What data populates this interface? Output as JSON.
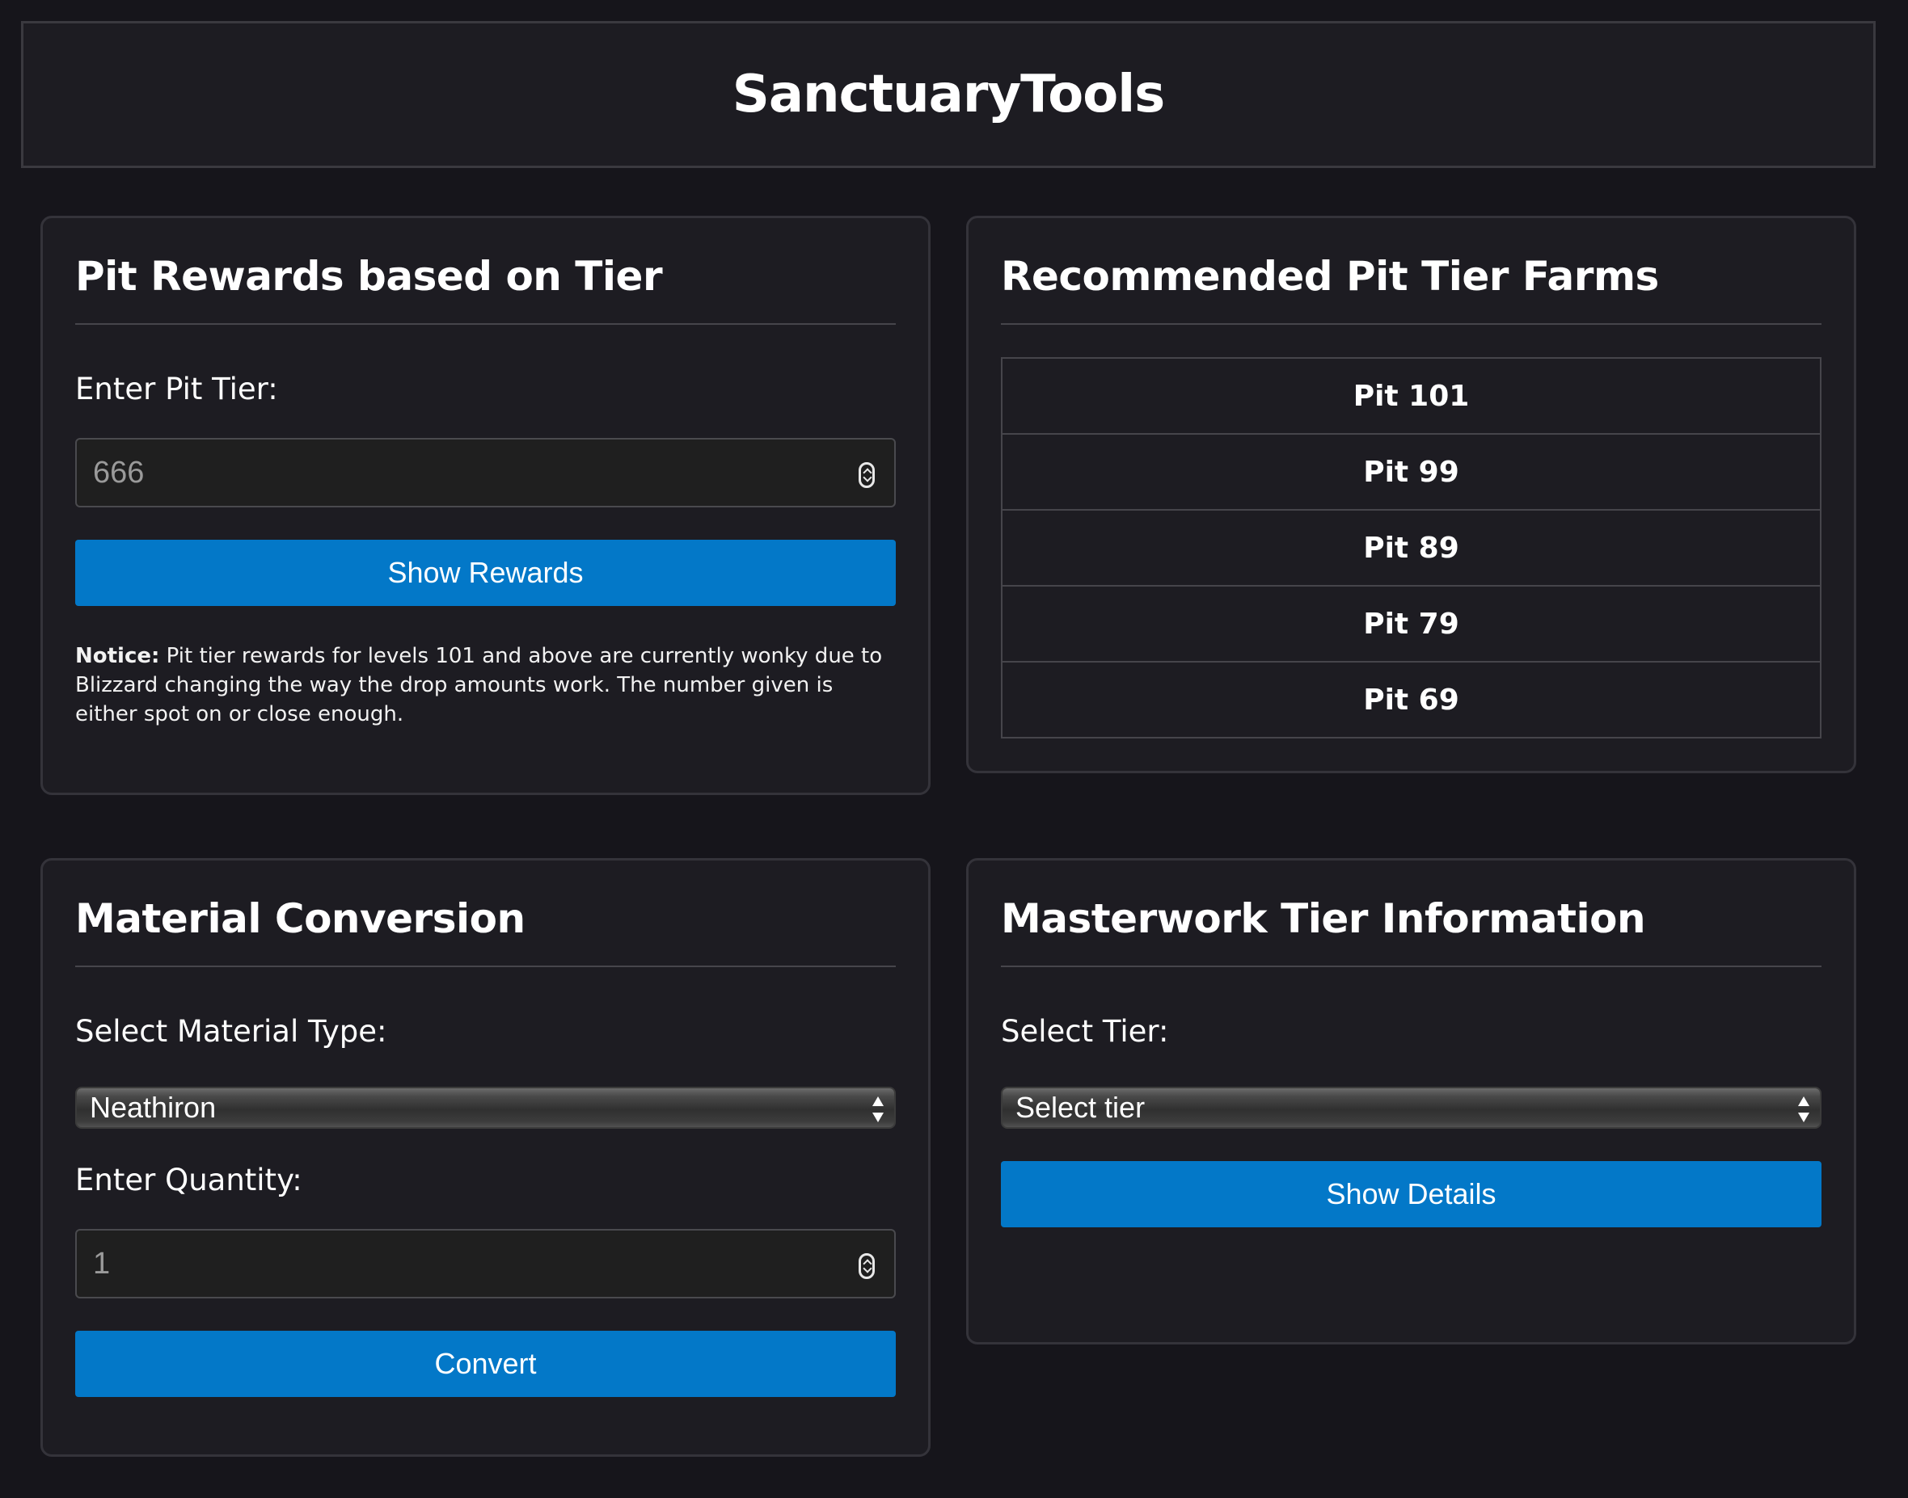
{
  "header": {
    "title": "SanctuaryTools"
  },
  "pit_rewards": {
    "title": "Pit Rewards based on Tier",
    "label": "Enter Pit Tier:",
    "input_value": "666",
    "button_label": "Show Rewards",
    "notice_bold": "Notice:",
    "notice_text": " Pit tier rewards for levels 101 and above are currently wonky due to Blizzard changing the way the drop amounts work. The number given is either spot on or close enough."
  },
  "recommended": {
    "title": "Recommended Pit Tier Farms",
    "rows": [
      "Pit 101",
      "Pit 99",
      "Pit 89",
      "Pit 79",
      "Pit 69"
    ]
  },
  "material": {
    "title": "Material Conversion",
    "type_label": "Select Material Type:",
    "type_selected": "Neathiron",
    "quantity_label": "Enter Quantity:",
    "quantity_value": "1",
    "button_label": "Convert"
  },
  "masterwork": {
    "title": "Masterwork Tier Information",
    "tier_label": "Select Tier:",
    "tier_selected": "Select tier",
    "button_label": "Show Details"
  },
  "colors": {
    "background": "#16151b",
    "card": "#1d1c22",
    "button": "#0378c8"
  }
}
